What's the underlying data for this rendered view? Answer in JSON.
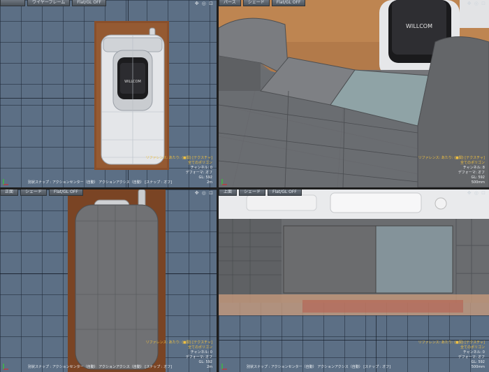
{
  "viewports": {
    "top_left": {
      "tabs": [
        "",
        "ワイヤーフレーム",
        "Flat/GL OFF"
      ],
      "status": "別状スナップ : アクションセンター（自動） アクションアクシス（自動） [スナップ : オフ]",
      "info": [
        "リファレンス: あたり: (■関) [テクスチャ]",
        "全てのポリゴン",
        "チャンネル: 0",
        "デフォーマ: オフ",
        "GL: 592",
        "2m"
      ]
    },
    "top_right": {
      "tabs": [
        "パース",
        "シェード",
        "Flat/GL OFF"
      ],
      "status": "",
      "info": [
        "リファレンス: あたり: (■関) [テクスチャ]",
        "全てのポリゴン",
        "チャンネル: 8",
        "デフォーマ: オフ",
        "GL: 592",
        "500mm"
      ]
    },
    "bottom_left": {
      "tabs": [
        "正面",
        "シェード",
        "Flat/GL OFF"
      ],
      "status": "別状スナップ : アクションセンター（自動） アクションアクシス（自動） [スナップ : オフ]",
      "info": [
        "リファレンス: あたり: (■関) [テクスチャ]",
        "全てのポリゴン",
        "チャンネル: 0",
        "デフォーマ: オフ",
        "GL: 592",
        "2m"
      ]
    },
    "bottom_right": {
      "tabs": [
        "上面",
        "シェード",
        "Flat/GL OFF"
      ],
      "status": "別状スナップ : アクションセンター（自動） アクションアクシス（自動） [スナップ : オフ]",
      "info": [
        "リファレンス: あたり: (■関) [テクスチャ]",
        "全てのポリゴン",
        "チャンネル: 0",
        "デフォーマ: オフ",
        "GL: 592",
        "500mm"
      ]
    }
  },
  "phone_logo": "WILLCOM",
  "viewport_controls": "✥ ◎ ⊡",
  "colors": {
    "grid_bg": "#5c6f85",
    "highlight": "#f0c040",
    "wood": "#8a4f2a",
    "mesh": "#6b6d70"
  }
}
